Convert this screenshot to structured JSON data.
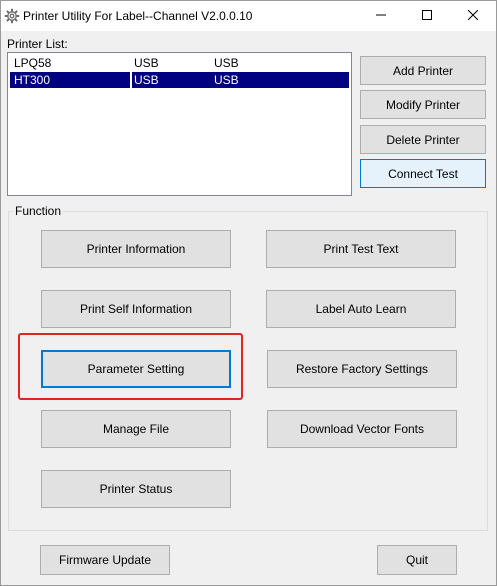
{
  "window": {
    "title": "Printer Utility For Label--Channel  V2.0.0.10",
    "icon": "gear-icon",
    "controls": {
      "minimize": "minimize-icon",
      "maximize": "maximize-icon",
      "close": "close-icon"
    }
  },
  "printer_list": {
    "label": "Printer List:",
    "rows": [
      {
        "name": "LPQ58",
        "port": "USB",
        "interface": "USB",
        "selected": false
      },
      {
        "name": "HT300",
        "port": "USB",
        "interface": "USB",
        "selected": true
      }
    ]
  },
  "printer_actions": {
    "add": "Add Printer",
    "modify": "Modify Printer",
    "delete": "Delete Printer",
    "connect_test": "Connect Test"
  },
  "function": {
    "label": "Function",
    "buttons": {
      "printer_information": "Printer Information",
      "print_test_text": "Print Test Text",
      "print_self_information": "Print Self Information",
      "label_auto_learn": "Label Auto Learn",
      "parameter_setting": "Parameter Setting",
      "restore_factory_settings": "Restore Factory Settings",
      "manage_file": "Manage File",
      "download_vector_fonts": "Download Vector Fonts",
      "printer_status": "Printer Status"
    }
  },
  "footer": {
    "firmware_update": "Firmware Update",
    "quit": "Quit"
  },
  "colors": {
    "selection": "#000080",
    "highlight_box": "#e02424",
    "focus_border": "#0078d7"
  }
}
